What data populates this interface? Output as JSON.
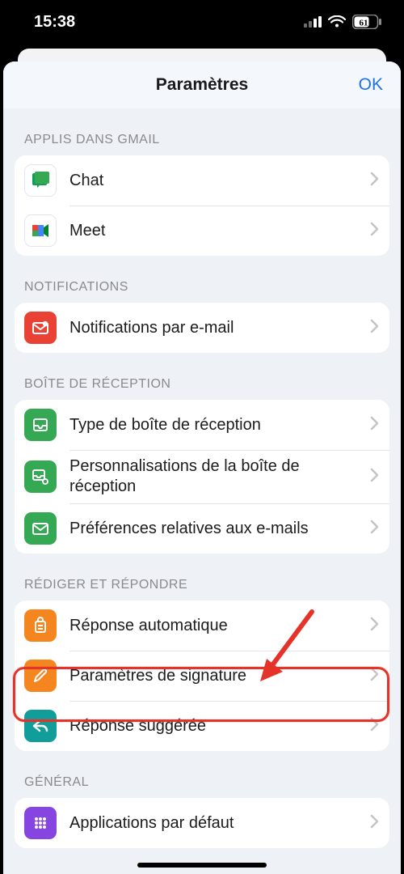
{
  "status": {
    "time": "15:38",
    "battery": "61"
  },
  "nav": {
    "title": "Paramètres",
    "ok": "OK"
  },
  "sections": {
    "apps": {
      "header": "APPLIS DANS GMAIL",
      "chat": "Chat",
      "meet": "Meet"
    },
    "notif": {
      "header": "NOTIFICATIONS",
      "email": "Notifications par e-mail"
    },
    "inbox": {
      "header": "BOÎTE DE RÉCEPTION",
      "type": "Type de boîte de réception",
      "custom": "Personnalisations de la boîte de réception",
      "prefs": "Préférences relatives aux e-mails"
    },
    "compose": {
      "header": "RÉDIGER ET RÉPONDRE",
      "auto": "Réponse automatique",
      "sig": "Paramètres de signature",
      "smart": "Réponse suggérée"
    },
    "general": {
      "header": "GÉNÉRAL",
      "default": "Applications par défaut"
    }
  }
}
